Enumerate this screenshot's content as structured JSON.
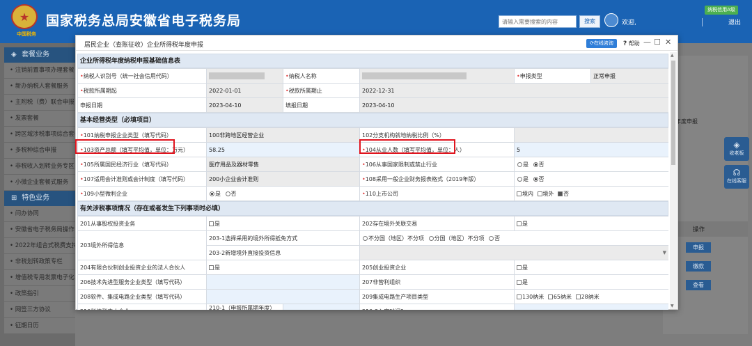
{
  "header": {
    "emblem_text": "中国税务",
    "site_title": "国家税务总局安徽省电子税务局",
    "search_placeholder": "请输入需要搜索的内容",
    "search_button": "搜索",
    "welcome": "欢迎",
    "badge": "纳税信用A级",
    "logout": "退出"
  },
  "sidebar": {
    "sections": [
      {
        "title": "套餐业务",
        "items": [
          "注销前置事项办理套餐",
          "新办纳税人套餐服务",
          "主附税（费）联合申报",
          "发票套餐",
          "跨区域涉税事项综合套餐",
          "多税种综合申报",
          "非税收入划转业务专区",
          "小微企业套餐式服务"
        ]
      },
      {
        "title": "特色业务",
        "items": [
          "问办协同",
          "安徽省电子税务局操作",
          "2022年组合式税费支持",
          "非税划转政策专栏",
          "增值税专用发票电子化",
          "政策指引",
          "网签三方协议",
          "征期日历"
        ]
      }
    ]
  },
  "background": {
    "text": "年度申报",
    "col_header": "操作",
    "buttons": [
      "申报",
      "缴款",
      "查看"
    ],
    "float_buttons": [
      {
        "icon": "◈",
        "label": "收老板"
      },
      {
        "icon": "☊",
        "label": "在线客服"
      }
    ]
  },
  "modal": {
    "title": "居民企业（查账征收）企业所得税年度申报",
    "online_button": "在线咨询",
    "help_label": "帮助",
    "section1": {
      "title": "企业所得税年度纳税申报基础信息表",
      "r1": {
        "l1": "纳税人识别号（统一社会信用代码）",
        "l2": "纳税人名称",
        "l3": "申报类型",
        "v3": "正常申报"
      },
      "r2": {
        "l1": "税款所属期起",
        "v1": "2022-01-01",
        "l2": "税款所属期止",
        "v2": "2022-12-31"
      },
      "r3": {
        "l1": "申报日期",
        "v1": "2023-04-10",
        "l2": "填报日期",
        "v2": "2023-04-10"
      }
    },
    "section2": {
      "title": "基本经营类型（必填项目）",
      "r1": {
        "l1": "101纳税申报企业类型（填写代码）",
        "v1": "100非跨地区经营企业",
        "l2": "102分支机构就地纳税比例（%）"
      },
      "r2": {
        "l1": "103资产总额（填写平均值，单位：万元）",
        "v1": "58.25",
        "l2": "104从业人数（填写平均值，单位：人）",
        "v2": "5"
      },
      "r3": {
        "l1": "105所属国民经济行业（填写代码）",
        "v1": "医疗用品及器材零售",
        "l2": "106从事国家限制或禁止行业",
        "o1": "是",
        "o2": "否"
      },
      "r4": {
        "l1": "107适用会计准则或会计制度（填写代码）",
        "v1": "200小企业会计准则",
        "l2": "108采用一般企业财务报表格式（2019年版）",
        "o1": "是",
        "o2": "否"
      },
      "r5": {
        "l1": "109小型微利企业",
        "o1": "是",
        "o2": "否",
        "l2": "110上市公司",
        "c1": "境内",
        "c2": "境外",
        "c3": "否"
      }
    },
    "section3": {
      "title": "有关涉税事项情况（存在或者发生下列事项时必填）",
      "r1": {
        "l1": "201从事股权投资业务",
        "c1": "是",
        "l2": "202存在境外关联交易",
        "c2": "是"
      },
      "r2": {
        "l1": "203境外所得信息",
        "l2": "203-1选择采用的境外所得抵免方式",
        "o1": "不分国（地区）不分项",
        "o2": "分国（地区）不分项",
        "o3": "否"
      },
      "r3": {
        "l2": "203-2新增境外直接投资信息"
      },
      "r4": {
        "l1": "204有限合伙制创业投资企业的法人合伙人",
        "c1": "是",
        "l2": "205创业投资企业",
        "c2": "是"
      },
      "r5": {
        "l1": "206技术先进型服务企业类型（填写代码）",
        "l2": "207非营利组织",
        "c2": "是"
      },
      "r6": {
        "l1": "208软件、集成电路企业类型（填写代码）",
        "l2": "209集成电路生产项目类型",
        "c1": "130纳米",
        "c2": "65纳米",
        "c3": "28纳米"
      },
      "r7": {
        "l1": "210科技型中小企业",
        "l2": "210-1（申报所属期年度）入库编号1",
        "l3": "210-2入库时间1"
      }
    }
  }
}
